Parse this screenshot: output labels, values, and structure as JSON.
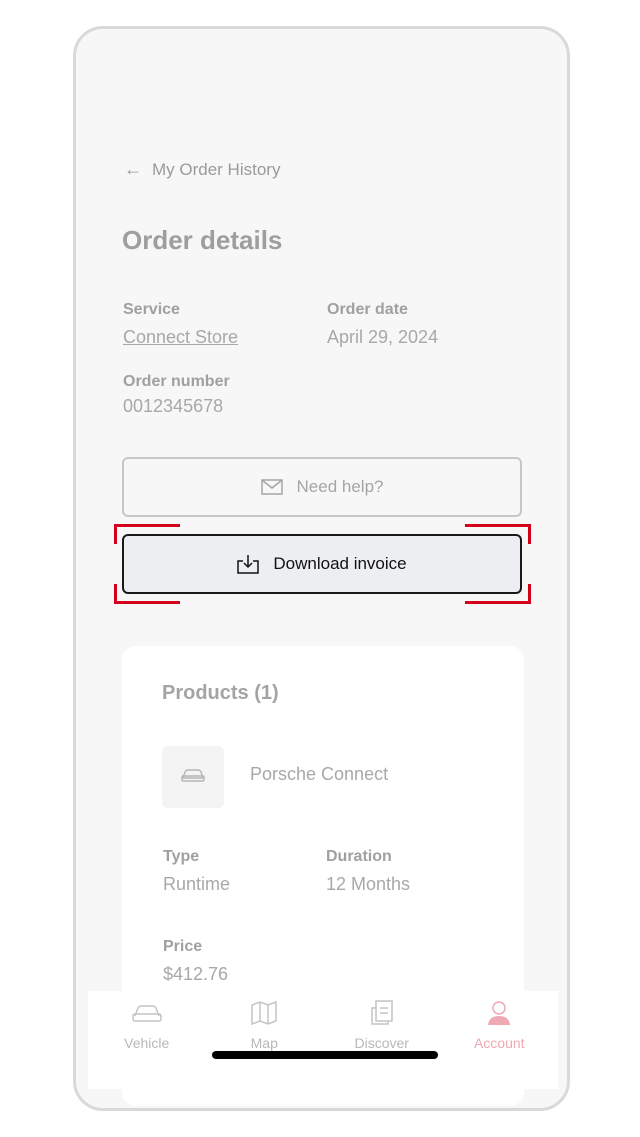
{
  "header": {
    "back_label": "My Order History",
    "title": "Order details"
  },
  "order": {
    "service_label": "Service",
    "service_value": "Connect Store",
    "date_label": "Order date",
    "date_value": "April 29, 2024",
    "number_label": "Order number",
    "number_value": "0012345678"
  },
  "actions": {
    "help_label": "Need help?",
    "download_label": "Download invoice"
  },
  "products": {
    "title": "Products (1)",
    "name": "Porsche Connect",
    "type_label": "Type",
    "type_value": "Runtime",
    "duration_label": "Duration",
    "duration_value": "12 Months",
    "price_label": "Price",
    "price_value": "$412.76"
  },
  "tabbar": {
    "items": [
      {
        "label": "Vehicle",
        "icon": "car-icon"
      },
      {
        "label": "Map",
        "icon": "map-icon"
      },
      {
        "label": "Discover",
        "icon": "news-icon"
      },
      {
        "label": "Account",
        "icon": "user-icon",
        "active": true
      }
    ]
  },
  "colors": {
    "highlight": "#d5001c",
    "active_tab": "#f0a8b2"
  }
}
